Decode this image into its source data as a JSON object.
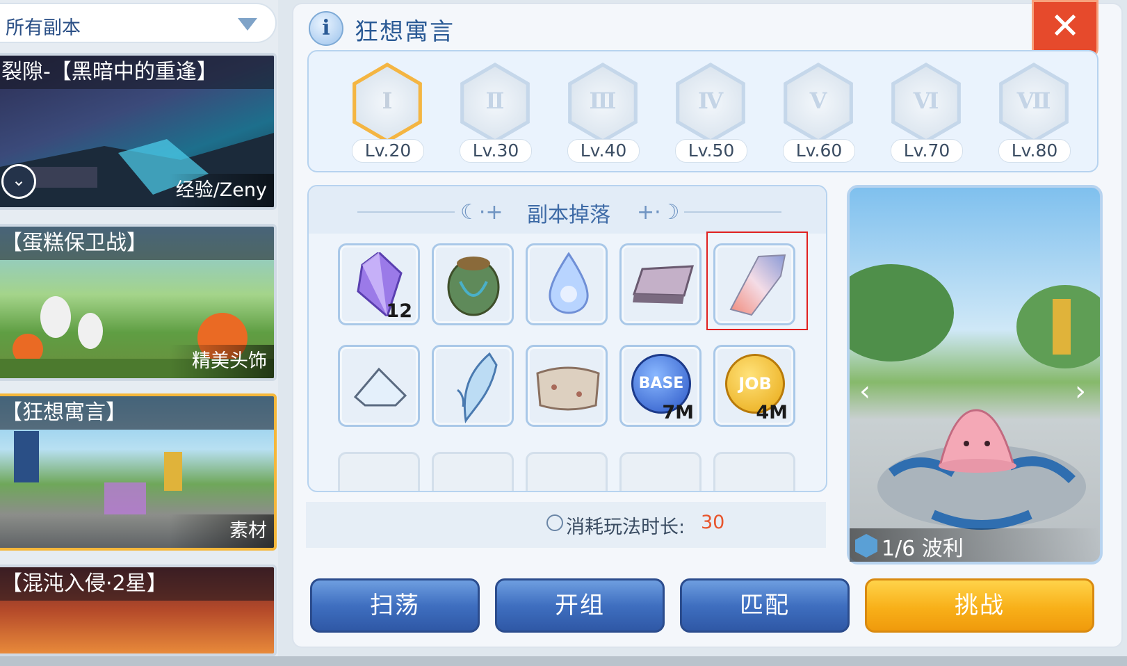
{
  "filter": {
    "label": "所有副本"
  },
  "dungeons": [
    {
      "title": "裂隙-【黑暗中的重逢】",
      "tag": "经验/Zeny",
      "selected": false
    },
    {
      "title": "【蛋糕保卫战】",
      "tag": "精美头饰",
      "selected": false
    },
    {
      "title": "【狂想寓言】",
      "tag": "素材",
      "selected": true
    },
    {
      "title": "【混沌入侵·2星】",
      "tag": "",
      "selected": false
    }
  ],
  "header": {
    "title": "狂想寓言",
    "info_glyph": "i",
    "close_glyph": "✕"
  },
  "levels": [
    {
      "numeral": "Ⅰ",
      "label": "Lv.20",
      "active": true
    },
    {
      "numeral": "Ⅱ",
      "label": "Lv.30",
      "active": false
    },
    {
      "numeral": "Ⅲ",
      "label": "Lv.40",
      "active": false
    },
    {
      "numeral": "Ⅳ",
      "label": "Lv.50",
      "active": false
    },
    {
      "numeral": "Ⅴ",
      "label": "Lv.60",
      "active": false
    },
    {
      "numeral": "Ⅵ",
      "label": "Lv.70",
      "active": false
    },
    {
      "numeral": "Ⅶ",
      "label": "Lv.80",
      "active": false
    }
  ],
  "drops": {
    "title": "副本掉落",
    "row1": [
      {
        "icon": "purple-crystal-icon",
        "count": "12"
      },
      {
        "icon": "seed-pod-icon",
        "count": ""
      },
      {
        "icon": "water-drop-icon",
        "count": ""
      },
      {
        "icon": "cloth-sheet-icon",
        "count": ""
      },
      {
        "icon": "shimmer-cloth-icon",
        "count": ""
      }
    ],
    "row2": [
      {
        "icon": "ice-shard-icon",
        "count": ""
      },
      {
        "icon": "feather-icon",
        "count": ""
      },
      {
        "icon": "old-cloth-icon",
        "count": ""
      },
      {
        "icon": "base-exp-icon",
        "badge": "BASE",
        "count": "7M"
      },
      {
        "icon": "job-exp-icon",
        "badge": "JOB",
        "count": "4M"
      }
    ]
  },
  "time": {
    "label": "消耗玩法时长:",
    "value": "30"
  },
  "preview": {
    "prev": "‹",
    "next": "›",
    "caption": "1/6 波利"
  },
  "buttons": {
    "sweep": "扫荡",
    "team": "开组",
    "match": "匹配",
    "challenge": "挑战"
  }
}
